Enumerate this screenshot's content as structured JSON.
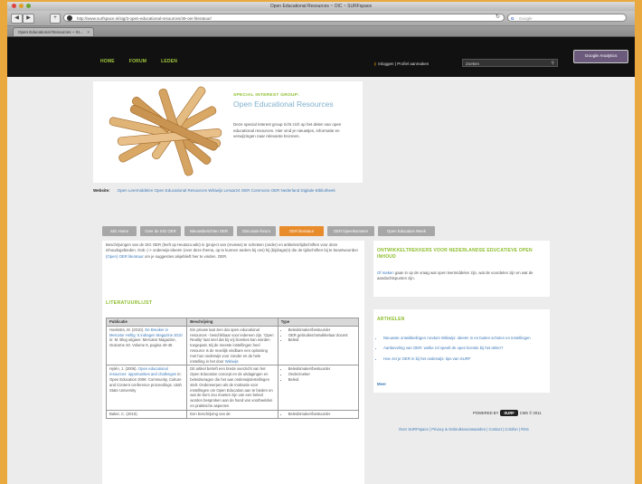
{
  "browser": {
    "window_title": "Open Educational Resources ~ OIC ~ SURFspace",
    "url": "http://www.surfspace.nl/sig/3-open-educational-resources/49-oer-literatuur/",
    "search_placeholder": "Google",
    "tab_label": "Open Educational Resources ~ SI...",
    "back": "◀",
    "forward": "▶",
    "add": "+",
    "reload": "↻"
  },
  "site_nav": {
    "links": [
      "HOME",
      "FORUM",
      "LEDEN"
    ],
    "login_text": "Inloggen  |  Profiel aanmaken",
    "search_placeholder": "Zoeken",
    "google_analytics": "Google Analytics"
  },
  "hero": {
    "group_label": "SPECIAL INTEREST GROUP:",
    "title": "Open Educational Resources",
    "description": "Deze special interest group richt zich op het delen van open educational resources. Hier vind je nieuwtjes, informatie en verwijzingen naar relevante bronnen."
  },
  "website": {
    "label": "Website:",
    "links": "Open Leermiddelen  Open Educational Resources  Wikiwijs  Leraar24  OER Commons  OER Nederland  Digitale Bibliotheek"
  },
  "tabs": [
    {
      "label": "SIG Home",
      "width": 38
    },
    {
      "label": "Over de SIG OER",
      "width": 45
    },
    {
      "label": "Nieuwsberichten OER",
      "width": 54
    },
    {
      "label": "Discussie-forum",
      "width": 43
    },
    {
      "label": "OER literatuur",
      "width": 49,
      "active": true
    },
    {
      "label": "OER bijeenkomsten",
      "width": 52
    },
    {
      "label": "Open Education Week",
      "width": 63
    }
  ],
  "intro": {
    "text": "Beschrijvingen van de SIG OER (leeft op Heutazo.wiki) in (project van (reviews) te schetsen (onder) en artikelen/tijdschriften voor deze inhoudsgebieden. Ook: (-> onderwijs-ideeën (over deze thema, op te kunnen anders bij ons) hij (bijdrage(n) die de tijdschriften bij te beantwoorden",
    "link_text": "(Open)  OER literatuur",
    "tail": "om je suggesties alsjeblieft hier te vinden. OER."
  },
  "literature": {
    "heading": "LITERATUURLIJST",
    "headers": [
      "Publicatie",
      "Beschrijving",
      "Type"
    ],
    "rows": [
      {
        "pub_plain": "Hoekstra, M. (2010). ",
        "pub_link": "De Breaker in Mercator Heftig: 5 indragen Magazine 2010",
        "pub_tail": " in: M. Blog uitgave: Mercator Magazine, Outcome 20. Volume 8, pagina 40-48",
        "desc": "Ein private laat zien dat open educational resources - beschikbaar voor iedereen zijn. 'Open Reality' laat snel dat bij vrij licenties kan worden toegepast. Bij de meeste instellingen heel resource is de moeilijk vindbare een oplossing met hun onderwijs voor zonder en de hele instelling in het door",
        "desc_link": "Wikiwijs",
        "types": [
          "Beleidsmaker/bestuurder",
          "OER gebruiker/ontwikkelaar docent",
          "Beleid"
        ]
      },
      {
        "pub_plain": "Hylén, J. (2006). ",
        "pub_link": "Open educational resources: opportunities and challenges",
        "pub_tail": " in: Open Education 2006: Community, Culture and Content conference proceedings. Utah State University",
        "desc": "Dit artikel betreft een brede overzicht van het Open Education concept en de uitdagingen en beleidsvragen die het aan onderwijsinstellingen stelt. Onderwerpen als de motivatie voor instellingen om Open Education aan te bieden en wat de kern zou moeten zijn van een beleid worden besproken aan de hand van voorbeelden en praktische aspecten",
        "desc_link": "",
        "types": [
          "Beleidsmaker/bestuurder",
          "Onderzoeker",
          "Beleid"
        ]
      },
      {
        "pub_plain": "Baker, C. (2010).",
        "pub_link": "",
        "pub_tail": "",
        "desc": "Een beschrijving van de",
        "desc_link": "",
        "types": [
          "Beleidsmaker/bestuurder"
        ]
      }
    ]
  },
  "side_box1": {
    "heading": "ONTWIKKELTREKKERS VOOR NEDERLANDSE EDUCATIEVE OPEN INHOUD",
    "link": "Of maken",
    "text": " gaan in op de vraag wat open leermiddelen zijn, wat de voordelen zijn en wat de aandachtspunten zijn."
  },
  "side_box2": {
    "heading": "ARTIKELEN",
    "items": [
      "Nieuwste ontwikkelingen rondom Wikiwijs: ideeën in en buiten scholen en instellingen",
      "Aanbeveling van OER: welke rol speelt de open licentie bij het delen?",
      "Hoe zet je OER in bij het onderwijs: tips van SURF"
    ],
    "more": "Meer"
  },
  "footer": {
    "powered_by": "POWERED BY",
    "logo": "SURF",
    "after": "CMS © 2011",
    "links": "Over SURFspace  |  Privacy & Gebruiksvoorwaarden  |  Contact  |  Colofon  |  RSS"
  }
}
